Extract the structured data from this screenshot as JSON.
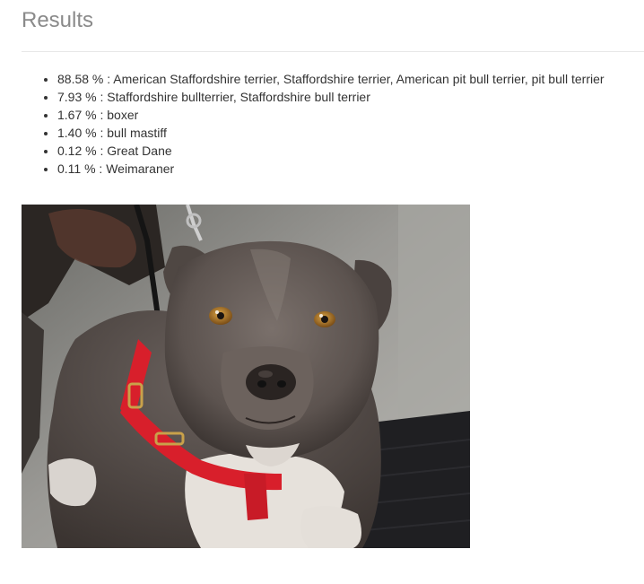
{
  "header": {
    "title": "Results"
  },
  "results": {
    "items": [
      {
        "percent": "88.58 %",
        "label": "American Staffordshire terrier, Staffordshire terrier, American pit bull terrier, pit bull terrier"
      },
      {
        "percent": "7.93 %",
        "label": "Staffordshire bullterrier, Staffordshire bull terrier"
      },
      {
        "percent": "1.67 %",
        "label": "boxer"
      },
      {
        "percent": "1.40 %",
        "label": "bull mastiff"
      },
      {
        "percent": "0.12 %",
        "label": "Great Dane"
      },
      {
        "percent": "0.11 %",
        "label": "Weimaraner"
      }
    ],
    "separator": " : "
  },
  "photo": {
    "subject": "dog-photo",
    "colors": {
      "fur": "#5f5652",
      "harness": "#d81f2b",
      "floor": "#8c8c88",
      "mat": "#1f1f22",
      "eyes": "#b07a2a"
    }
  }
}
